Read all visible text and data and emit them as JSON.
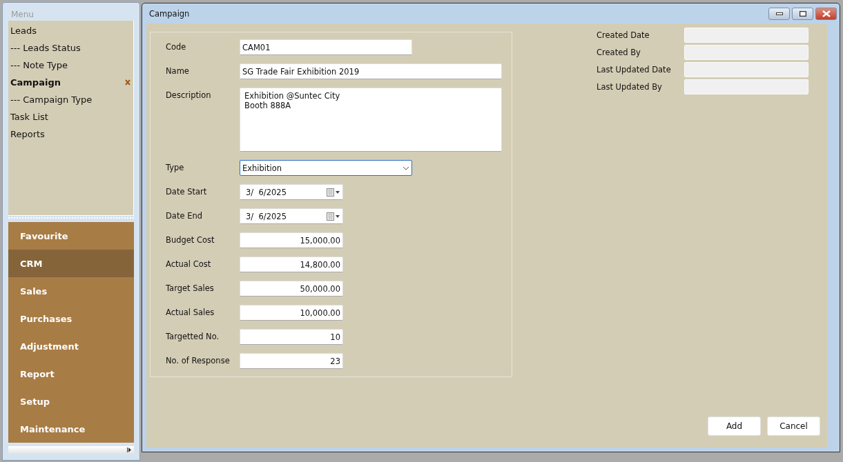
{
  "menu": {
    "title": "Menu",
    "tree": [
      {
        "label": "Leads",
        "selected": false
      },
      {
        "label": "--- Leads Status",
        "selected": false
      },
      {
        "label": "--- Note Type",
        "selected": false
      },
      {
        "label": "Campaign",
        "selected": true
      },
      {
        "label": "--- Campaign Type",
        "selected": false
      },
      {
        "label": "Task List",
        "selected": false
      },
      {
        "label": "Reports",
        "selected": false
      }
    ],
    "modules": [
      {
        "label": "Favourite",
        "selected": false
      },
      {
        "label": "CRM",
        "selected": true
      },
      {
        "label": "Sales",
        "selected": false
      },
      {
        "label": "Purchases",
        "selected": false
      },
      {
        "label": "Adjustment",
        "selected": false
      },
      {
        "label": "Report",
        "selected": false
      },
      {
        "label": "Setup",
        "selected": false
      },
      {
        "label": "Maintenance",
        "selected": false
      }
    ]
  },
  "window": {
    "title": "Campaign"
  },
  "form": [
    {
      "label": "Code",
      "kind": "text",
      "value": "CAM01"
    },
    {
      "label": "Name",
      "kind": "wide",
      "value": "SG Trade Fair Exhibition 2019"
    },
    {
      "label": "Description",
      "kind": "textarea",
      "value": "Exhibition @Suntec City\nBooth 888A"
    },
    {
      "label": "Type",
      "kind": "select",
      "value": "Exhibition",
      "focused": true
    },
    {
      "label": "Date Start",
      "kind": "date",
      "value": "3/  6/2025"
    },
    {
      "label": "Date End",
      "kind": "date",
      "value": "3/  6/2025"
    },
    {
      "label": "Budget Cost",
      "kind": "number",
      "value": "15,000.00"
    },
    {
      "label": "Actual Cost",
      "kind": "number",
      "value": "14,800.00"
    },
    {
      "label": "Target Sales",
      "kind": "number",
      "value": "50,000.00"
    },
    {
      "label": "Actual Sales",
      "kind": "number",
      "value": "10,000.00"
    },
    {
      "label": "Targetted No.",
      "kind": "number",
      "value": "10"
    },
    {
      "label": "No. of Response",
      "kind": "number",
      "value": "23"
    }
  ],
  "audit": [
    {
      "label": "Created Date"
    },
    {
      "label": "Created By"
    },
    {
      "label": "Last Updated Date"
    },
    {
      "label": "Last Updated By"
    }
  ],
  "buttons": [
    "Add",
    "Cancel"
  ]
}
